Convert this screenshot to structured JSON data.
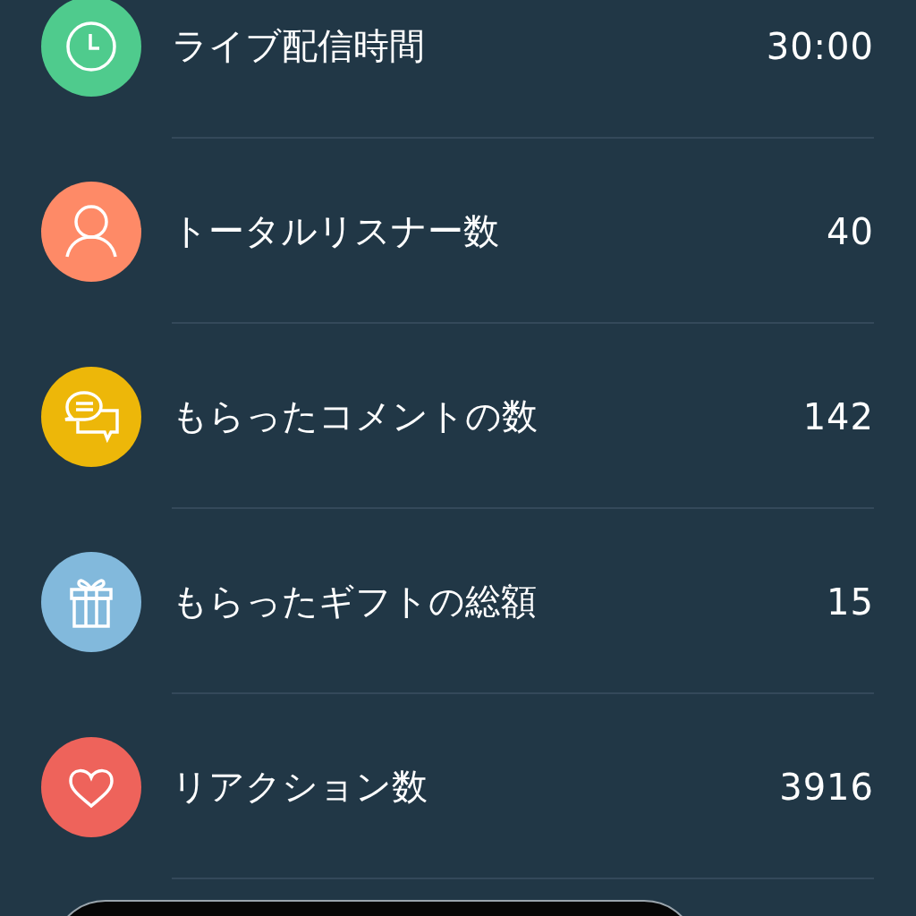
{
  "stats": [
    {
      "kind": "clock",
      "color": "#4fcb8d",
      "label": "ライブ配信時間",
      "value": "30:00"
    },
    {
      "kind": "person",
      "color": "#fe8a67",
      "label": "トータルリスナー数",
      "value": "40"
    },
    {
      "kind": "chat",
      "color": "#edb709",
      "label": "もらったコメントの数",
      "value": "142"
    },
    {
      "kind": "gift",
      "color": "#82b9dc",
      "label": "もらったギフトの総額",
      "value": "15"
    },
    {
      "kind": "heart",
      "color": "#ee635b",
      "label": "リアクション数",
      "value": "3916"
    }
  ]
}
